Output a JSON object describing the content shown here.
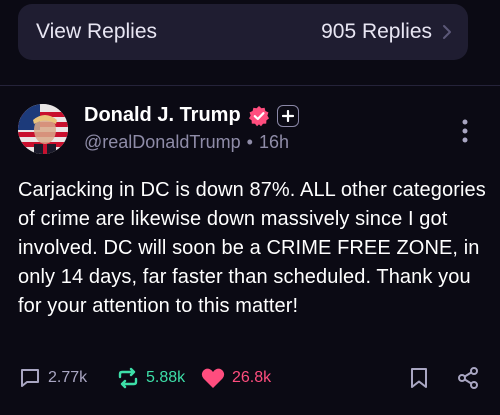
{
  "replies": {
    "view_label": "View Replies",
    "count_label": "905 Replies"
  },
  "post": {
    "author_name": "Donald J. Trump",
    "handle": "@realDonaldTrump",
    "separator": "•",
    "time": "16h",
    "text": "Carjacking in DC is down 87%. ALL other categories of crime are likewise down massively since I got involved. DC will soon be a CRIME FREE ZONE, in only 14 days, far faster than scheduled. Thank you for your attention to this matter!",
    "reply_count": "2.77k",
    "retruth_count": "5.88k",
    "like_count": "26.8k"
  },
  "colors": {
    "background": "#0b0a14",
    "card": "#1f1d31",
    "retruth": "#3ddfa8",
    "like": "#ff4d7e",
    "verified": "#ff4d7e",
    "muted": "#8f8ca8"
  }
}
